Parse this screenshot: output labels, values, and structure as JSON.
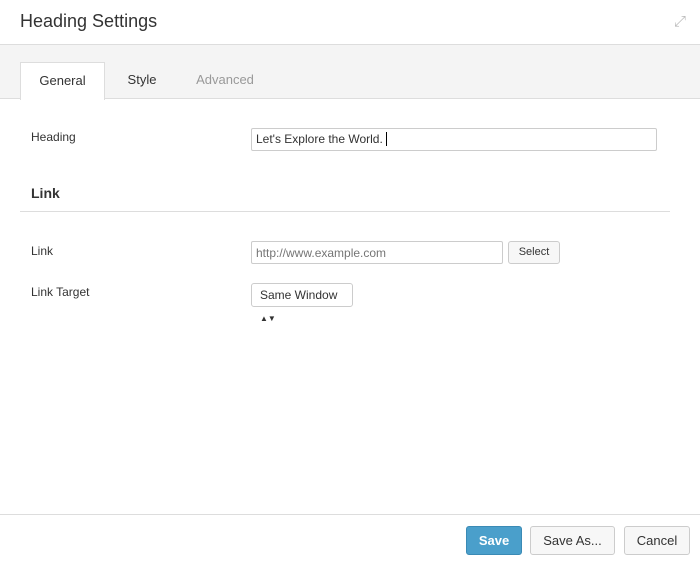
{
  "header": {
    "title": "Heading Settings",
    "expand_icon": "expand-icon"
  },
  "tabs": [
    {
      "label": "General"
    },
    {
      "label": "Style"
    },
    {
      "label": "Advanced"
    }
  ],
  "fields": {
    "heading": {
      "label": "Heading",
      "value": "Let's Explore the World."
    },
    "section_link": "Link",
    "link": {
      "label": "Link",
      "placeholder": "http://www.example.com",
      "select_label": "Select"
    },
    "link_target": {
      "label": "Link Target",
      "value": "Same Window"
    }
  },
  "footer": {
    "save": "Save",
    "save_as": "Save As...",
    "cancel": "Cancel"
  },
  "colors": {
    "primary": "#4a9fcb"
  }
}
